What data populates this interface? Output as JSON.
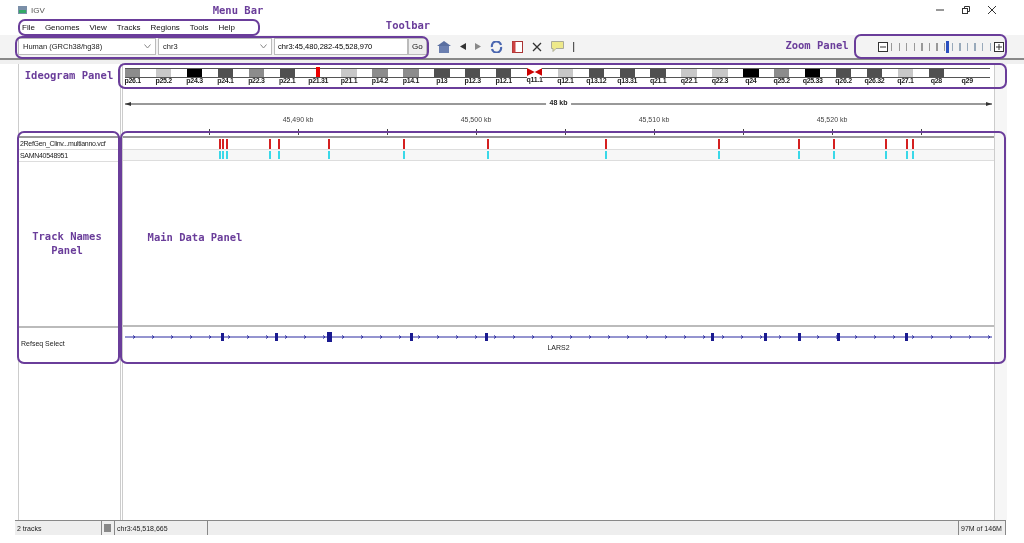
{
  "window": {
    "title": "IGV"
  },
  "menu": [
    "File",
    "Genomes",
    "View",
    "Tracks",
    "Regions",
    "Tools",
    "Help"
  ],
  "toolbar": {
    "genome": "Human (GRCh38/hg38)",
    "chromosome": "chr3",
    "locus": "chr3:45,480,282-45,528,970",
    "go": "Go",
    "zoom": {
      "level": 0.55
    }
  },
  "ideogram": {
    "bands": [
      {
        "label": "p26.1",
        "kind": "gpos50",
        "current": false
      },
      {
        "label": "p25.2",
        "kind": "gpos25",
        "current": false
      },
      {
        "label": "p24.3",
        "kind": "gpos100",
        "current": false
      },
      {
        "label": "p24.1",
        "kind": "gpos75",
        "current": false
      },
      {
        "label": "p22.3",
        "kind": "gpos50",
        "current": false
      },
      {
        "label": "p22.1",
        "kind": "gpos75",
        "current": false
      },
      {
        "label": "p21.31",
        "kind": "gneg",
        "current": true
      },
      {
        "label": "p21.1",
        "kind": "gpos25",
        "current": false
      },
      {
        "label": "p14.2",
        "kind": "gpos50",
        "current": false
      },
      {
        "label": "p14.1",
        "kind": "gpos50",
        "current": false
      },
      {
        "label": "p13",
        "kind": "gpos75",
        "current": false
      },
      {
        "label": "p12.3",
        "kind": "gpos75",
        "current": false
      },
      {
        "label": "p12.1",
        "kind": "gpos75",
        "current": false
      },
      {
        "label": "q11.1",
        "kind": "acen",
        "current": false
      },
      {
        "label": "q12.1",
        "kind": "gpos25",
        "current": false
      },
      {
        "label": "q13.12",
        "kind": "gpos75",
        "current": false
      },
      {
        "label": "q13.31",
        "kind": "gpos75",
        "current": false
      },
      {
        "label": "q21.1",
        "kind": "gpos75",
        "current": false
      },
      {
        "label": "q22.1",
        "kind": "gpos25",
        "current": false
      },
      {
        "label": "q22.3",
        "kind": "gpos25",
        "current": false
      },
      {
        "label": "q24",
        "kind": "gpos100",
        "current": false
      },
      {
        "label": "q25.2",
        "kind": "gpos50",
        "current": false
      },
      {
        "label": "q25.33",
        "kind": "gpos100",
        "current": false
      },
      {
        "label": "q26.2",
        "kind": "gpos75",
        "current": false
      },
      {
        "label": "q26.32",
        "kind": "gpos75",
        "current": false
      },
      {
        "label": "q27.1",
        "kind": "gpos25",
        "current": false
      },
      {
        "label": "q28",
        "kind": "gpos75",
        "current": false
      },
      {
        "label": "q29",
        "kind": "gneg",
        "current": false
      }
    ]
  },
  "ruler": {
    "span": "48 kb",
    "ticks": [
      "45,490 kb",
      "45,500 kb",
      "45,510 kb",
      "45,520 kb"
    ]
  },
  "tracks": [
    {
      "name": "2RefGen_Clinv...multianno.vcf",
      "kind": "variants"
    },
    {
      "name": "SAMN40548951",
      "kind": "genotypes"
    },
    {
      "name": "Refseq Select",
      "kind": "gene",
      "gene": "LARS2"
    }
  ],
  "status_bar": {
    "tracks": "2 tracks",
    "position": "chr3:45,518,665",
    "memory": "97M of 146M"
  },
  "annotations": [
    {
      "label": "Menu Bar"
    },
    {
      "label": "Toolbar"
    },
    {
      "label": "Zoom Panel"
    },
    {
      "label": "Ideogram Panel"
    },
    {
      "label": "Track Names Panel"
    },
    {
      "label": "Main Data Panel"
    }
  ]
}
